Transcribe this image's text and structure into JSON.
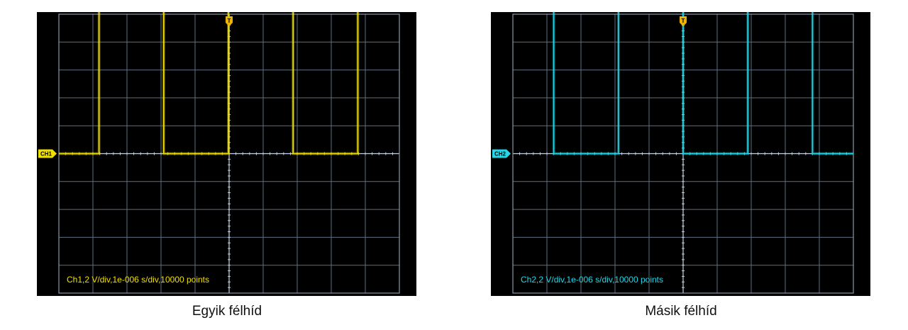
{
  "chart_data": [
    {
      "type": "line",
      "channel_tag": "CH1",
      "trigger_marker": "T",
      "readout": "Ch1,2 V/div,1e-006 s/div,10000 points",
      "caption": "Egyik félhíd",
      "color": "#f0e000",
      "divisions": {
        "x": 10,
        "y": 10
      },
      "xlim": [
        0,
        10
      ],
      "ylim": [
        -4,
        4
      ],
      "y_unit_per_div": "2 V/div",
      "x_unit_per_div": "1e-006 s/div",
      "points": 10000,
      "series": [
        {
          "x": [
            0,
            1.18,
            1.18,
            3.08,
            3.08,
            4.98,
            4.98,
            6.88,
            6.88,
            8.78,
            8.78,
            10
          ],
          "y": [
            0,
            0,
            4.5,
            4.5,
            0,
            0,
            4.5,
            4.5,
            0,
            0,
            4.5,
            4.5
          ]
        }
      ]
    },
    {
      "type": "line",
      "channel_tag": "CH2",
      "trigger_marker": "T",
      "readout": "Ch2,2 V/div,1e-006 s/div,10000 points",
      "caption": "Másik félhíd",
      "color": "#22d8e8",
      "divisions": {
        "x": 10,
        "y": 10
      },
      "xlim": [
        0,
        10
      ],
      "ylim": [
        -4,
        4
      ],
      "y_unit_per_div": "2 V/div",
      "x_unit_per_div": "1e-006 s/div",
      "points": 10000,
      "series": [
        {
          "x": [
            0,
            1.2,
            1.2,
            3.1,
            3.1,
            5.0,
            5.0,
            6.9,
            6.9,
            8.8,
            8.8,
            10
          ],
          "y": [
            4.5,
            4.5,
            0,
            0,
            4.5,
            4.5,
            0,
            0,
            4.5,
            4.5,
            0,
            0
          ]
        }
      ]
    }
  ],
  "colors": {
    "grid": "#5f6e82",
    "center": "#c7d2e2",
    "border": "#8a97aa"
  }
}
